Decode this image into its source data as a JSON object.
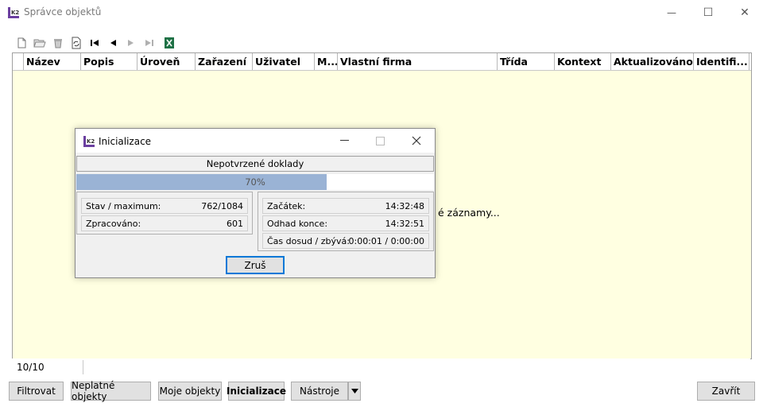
{
  "window": {
    "title": "Správce objektů",
    "minimize_glyph": "—",
    "maximize_glyph": "☐",
    "close_glyph": "✕"
  },
  "toolbar": {
    "icons": [
      "new-icon",
      "open-icon",
      "delete-icon",
      "refresh-icon",
      "first-record-icon",
      "previous-record-icon",
      "next-record-icon",
      "last-record-icon",
      "excel-export-icon"
    ]
  },
  "grid": {
    "columns": [
      "Název",
      "Popis",
      "Úroveň",
      "Zařazení",
      "Uživatel",
      "M...",
      "Vlastní firma",
      "Třída",
      "Kontext",
      "Aktualizováno",
      "Identifi..."
    ],
    "message_tail": "é záznamy..."
  },
  "statusbar": {
    "count": "10/10"
  },
  "buttons": {
    "filtrovat": "Filtrovat",
    "neplatne": "Neplatné objekty",
    "moje": "Moje objekty",
    "inicializace": "Inicializace",
    "nastroje": "Nástroje",
    "zavrit": "Zavřít"
  },
  "dialog": {
    "title": "Inicializace",
    "stage": "Nepotvrzené doklady",
    "progress_text": "70%",
    "progress_fraction": 0.7,
    "left_rows": [
      {
        "label": "Stav / maximum:",
        "value": "762/1084"
      },
      {
        "label": "Zpracováno:",
        "value": "601"
      }
    ],
    "right_rows": [
      {
        "label": "Začátek:",
        "value": "14:32:48"
      },
      {
        "label": "Odhad konce:",
        "value": "14:32:51"
      },
      {
        "label": "Čas dosud / zbývá:",
        "value": "0:00:01 / 0:00:00"
      }
    ],
    "cancel_label": "Zruš"
  },
  "colors": {
    "grid_background": "#ffffe1",
    "progress_fill": "#9ab3d5",
    "focus_border": "#0078d7"
  }
}
